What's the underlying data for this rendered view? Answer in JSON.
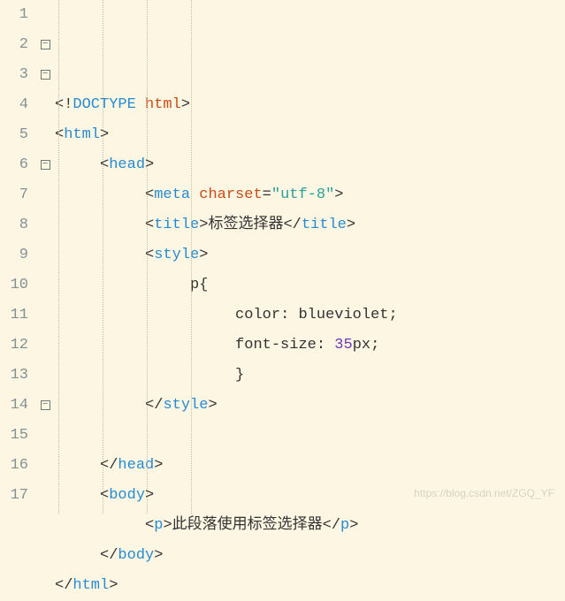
{
  "editor": {
    "language": "html",
    "watermark": "https://blog.csdn.net/ZGQ_YF",
    "foldMarkers": {
      "2": true,
      "3": true,
      "6": true,
      "14": true
    },
    "lines": [
      {
        "n": 1,
        "indent": 0,
        "type": "doctype",
        "content": "<!DOCTYPE html>"
      },
      {
        "n": 2,
        "indent": 0,
        "type": "tag-open",
        "tag": "html"
      },
      {
        "n": 3,
        "indent": 1,
        "type": "tag-open",
        "tag": "head"
      },
      {
        "n": 4,
        "indent": 2,
        "type": "meta",
        "tag": "meta",
        "attr": "charset",
        "val": "\"utf-8\""
      },
      {
        "n": 5,
        "indent": 2,
        "type": "tag-pair",
        "tag": "title",
        "text": "标签选择器"
      },
      {
        "n": 6,
        "indent": 2,
        "type": "tag-open",
        "tag": "style"
      },
      {
        "n": 7,
        "indent": 3,
        "type": "css-sel",
        "sel": "p{"
      },
      {
        "n": 8,
        "indent": 4,
        "type": "css-decl",
        "prop": "color",
        "pval": "blueviolet;"
      },
      {
        "n": 9,
        "indent": 4,
        "type": "css-decl",
        "prop": "font-size",
        "pval": "35px;",
        "numeric": "35",
        "unit": "px;"
      },
      {
        "n": 10,
        "indent": 4,
        "type": "css-close",
        "sel": "}"
      },
      {
        "n": 11,
        "indent": 2,
        "type": "tag-close",
        "tag": "style"
      },
      {
        "n": 12,
        "indent": 2,
        "type": "blank"
      },
      {
        "n": 13,
        "indent": 1,
        "type": "tag-close",
        "tag": "head"
      },
      {
        "n": 14,
        "indent": 1,
        "type": "tag-open",
        "tag": "body"
      },
      {
        "n": 15,
        "indent": 2,
        "type": "tag-pair",
        "tag": "p",
        "text": "此段落使用标签选择器"
      },
      {
        "n": 16,
        "indent": 1,
        "type": "tag-close",
        "tag": "body"
      },
      {
        "n": 17,
        "indent": 0,
        "type": "tag-close",
        "tag": "html"
      }
    ]
  }
}
